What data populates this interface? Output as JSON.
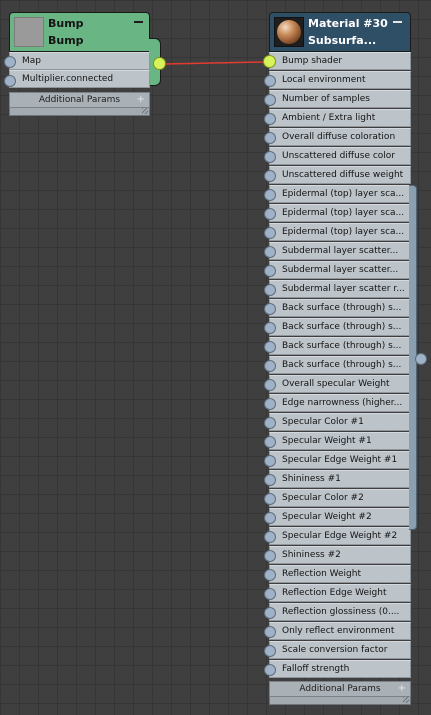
{
  "bump_node": {
    "title_line1": "Bump",
    "title_line2": "Bump",
    "ports": [
      "Map",
      "Multiplier.connected"
    ],
    "footer_label": "Additional Params",
    "header_color": "#69b584"
  },
  "material_node": {
    "title_line1": "Material #30",
    "title_line2": "Subsurfa...",
    "ports": [
      "Bump shader",
      "Local environment",
      "Number of samples",
      "Ambient / Extra light",
      "Overall diffuse coloration",
      "Unscattered diffuse color",
      "Unscattered diffuse weight",
      "Epidermal (top) layer sca...",
      "Epidermal (top) layer sca...",
      "Epidermal (top) layer sca...",
      "Subdermal layer scatter...",
      "Subdermal layer scatter...",
      "Subdermal layer scatter r...",
      "Back surface (through) s...",
      "Back surface (through) s...",
      "Back surface (through) s...",
      "Back surface (through) s...",
      "Overall specular Weight",
      "Edge narrowness (higher...",
      "Specular Color #1",
      "Specular Weight #1",
      "Specular Edge Weight #1",
      "Shininess #1",
      "Specular Color #2",
      "Specular Weight #2",
      "Specular Edge Weight #2",
      "Shininess #2",
      "Reflection Weight",
      "Reflection Edge Weight",
      "Reflection glossiness (0....",
      "Only reflect environment",
      "Scale conversion factor",
      "Falloff strength"
    ],
    "footer_label": "Additional Params",
    "header_color": "#2f4f66"
  },
  "wire_color": "#e23b2f",
  "connected_socket_color": "#d6f35b"
}
